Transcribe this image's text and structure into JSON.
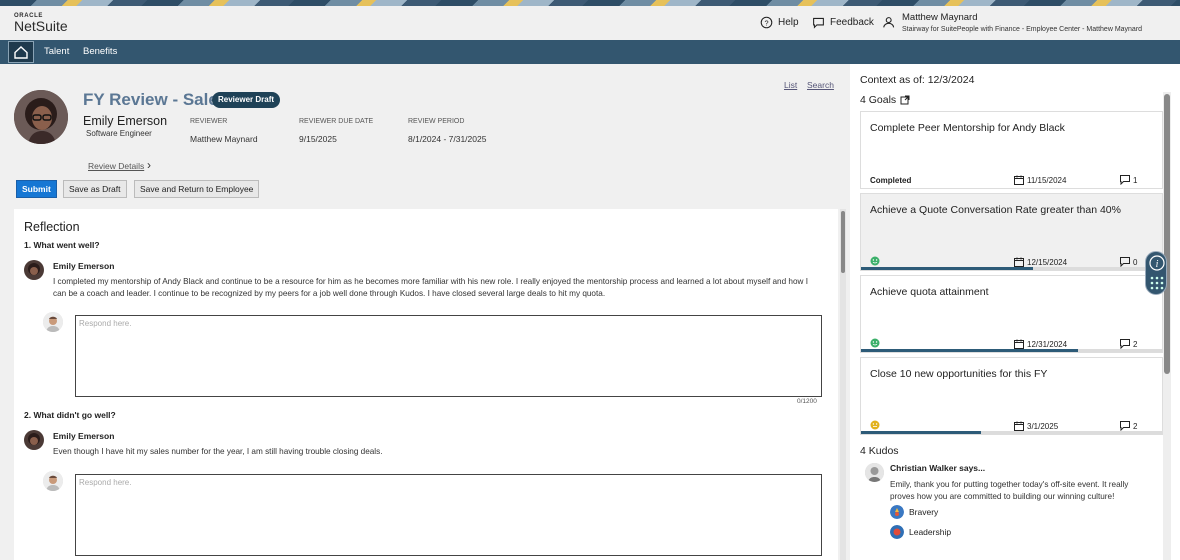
{
  "brand": {
    "oracle": "ORACLE",
    "netsuite": "NetSuite"
  },
  "topbar": {
    "help": "Help",
    "feedback": "Feedback",
    "user_name": "Matthew Maynard",
    "user_context": "Stairway for SuitePeople with Finance - Employee Center - Matthew Maynard"
  },
  "nav": {
    "items": [
      {
        "label": "Talent"
      },
      {
        "label": "Benefits"
      }
    ]
  },
  "review": {
    "title": "FY Review - Sales",
    "status": "Reviewer Draft",
    "employee_name": "Emily Emerson",
    "employee_role": "Software Engineer",
    "fields": [
      {
        "label": "REVIEWER",
        "value": "Matthew Maynard"
      },
      {
        "label": "REVIEWER DUE DATE",
        "value": "9/15/2025"
      },
      {
        "label": "REVIEW PERIOD",
        "value": "8/1/2024 - 7/31/2025"
      }
    ],
    "links": {
      "list": "List",
      "search": "Search"
    },
    "details_link": "Review Details",
    "buttons": {
      "submit": "Submit",
      "save_draft": "Save as Draft",
      "save_return": "Save and Return to Employee"
    }
  },
  "reflection": {
    "heading": "Reflection",
    "questions": [
      {
        "question": "1. What went well?",
        "author": "Emily Emerson",
        "answer": "I completed my mentorship of Andy Black and continue to be a resource for him as he becomes more familiar with his new role. I really enjoyed the mentorship process and learned a lot about myself and how I can be a coach and leader.  I continue to be recognized by my peers for a job well done through Kudos. I have closed several large deals to hit my quota.",
        "placeholder": "Respond here.",
        "counter": "0/1200"
      },
      {
        "question": "2. What didn't go well?",
        "author": "Emily Emerson",
        "answer": "Even though I have hit my sales number for the year, I am still having trouble closing deals.",
        "placeholder": "Respond here.",
        "counter": "0/1200"
      }
    ]
  },
  "context": {
    "label": "Context as of: 12/3/2024"
  },
  "goals": {
    "heading": "4 Goals",
    "items": [
      {
        "title": "Complete Peer Mentorship for Andy Black",
        "status": "Completed",
        "date": "11/15/2024",
        "comments": "1",
        "progress": 1.0,
        "mood": "none"
      },
      {
        "title": "Achieve a Quote Conversation Rate greater than 40%",
        "status": "",
        "date": "12/15/2024",
        "comments": "0",
        "progress": 0.57,
        "mood": "good"
      },
      {
        "title": "Achieve quota attainment",
        "status": "",
        "date": "12/31/2024",
        "comments": "2",
        "progress": 0.72,
        "mood": "good"
      },
      {
        "title": "Close 10 new opportunities for this FY",
        "status": "",
        "date": "3/1/2025",
        "comments": "2",
        "progress": 0.4,
        "mood": "neutral"
      }
    ]
  },
  "kudos": {
    "heading": "4 Kudos",
    "author": "Christian Walker says...",
    "text": "Emily, thank you for putting together today's off-site event. It really proves how you are committed to building our winning culture!",
    "badges": [
      {
        "label": "Bravery"
      },
      {
        "label": "Leadership"
      }
    ]
  },
  "colors": {
    "nav": "#33566f",
    "primary": "#1677d4",
    "title": "#5b7794",
    "badge": "#1f4257",
    "progress": "#2d5b78",
    "mood_good": "#3bb06a",
    "mood_neutral": "#e2b21c"
  }
}
